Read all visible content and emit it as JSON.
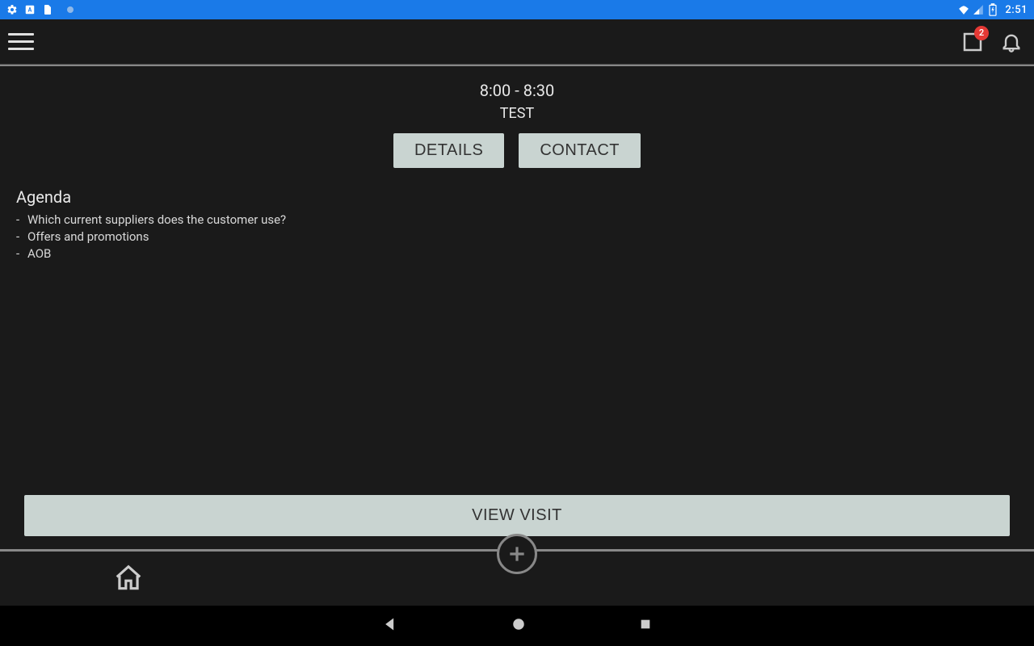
{
  "status_bar": {
    "time": "2:51",
    "badge_count": "2"
  },
  "event": {
    "time_range": "8:00 - 8:30",
    "title": "TEST"
  },
  "buttons": {
    "details": "DETAILS",
    "contact": "CONTACT",
    "view_visit": "VIEW VISIT"
  },
  "agenda": {
    "heading": "Agenda",
    "items": [
      "Which current suppliers does the customer use?",
      "Offers and promotions",
      "AOB"
    ]
  }
}
